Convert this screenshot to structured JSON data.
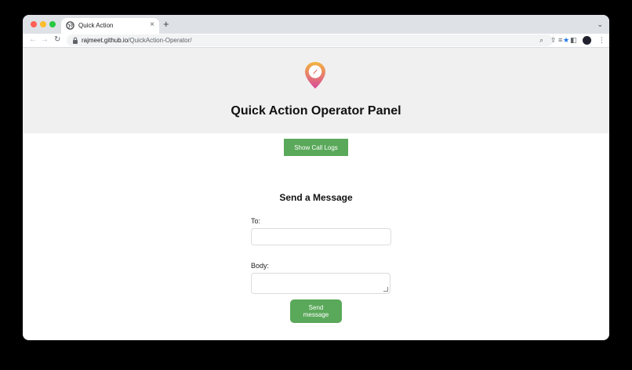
{
  "browser": {
    "tab_title": "Quick Action",
    "tab_close": "×",
    "new_tab": "+",
    "tab_search": "⌄",
    "nav": {
      "back": "←",
      "forward": "→",
      "reload": "↻"
    },
    "url_host": "rajmeet.github.io",
    "url_path": "/QuickAction-Operator/",
    "omnibox_icons": {
      "zoom": "⌕",
      "share": "⇪",
      "star": "★"
    },
    "toolbar_icons": {
      "extensions": "≡",
      "side_panel": "◧",
      "menu": "⋮"
    },
    "accent_star_color": "#1a73e8"
  },
  "page": {
    "title": "Quick Action Operator Panel",
    "header_background": "#f0f0f0",
    "call_logs_button": "Show Call Logs",
    "message_section_title": "Send a Message",
    "to_label": "To:",
    "to_value": "",
    "body_label": "Body:",
    "body_value": "",
    "send_button": "Send message",
    "button_color": "#5aa85a",
    "logo": "compass-pin-icon"
  }
}
